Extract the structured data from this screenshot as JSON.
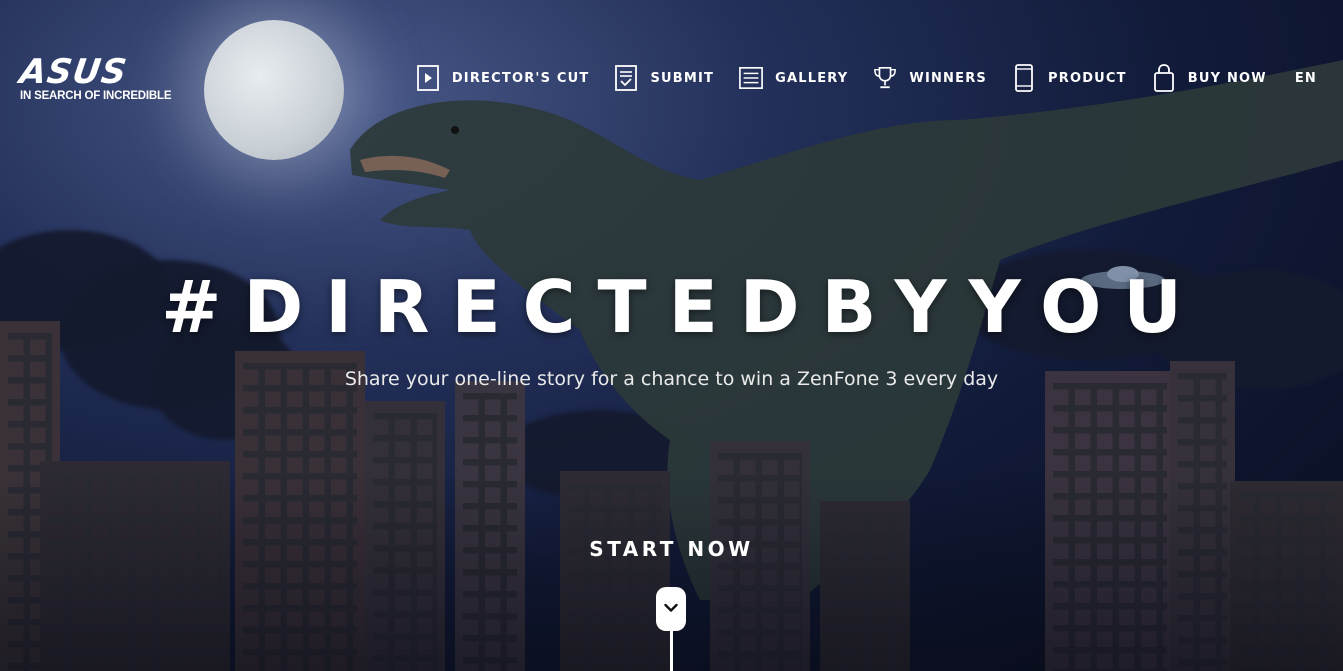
{
  "brand": {
    "logo_text": "ASUS",
    "tagline": "IN SEARCH OF INCREDIBLE"
  },
  "nav": {
    "items": [
      {
        "label": "DIRECTOR'S CUT",
        "icon": "play-icon"
      },
      {
        "label": "SUBMIT",
        "icon": "submit-icon"
      },
      {
        "label": "GALLERY",
        "icon": "gallery-icon"
      },
      {
        "label": "WINNERS",
        "icon": "trophy-icon"
      },
      {
        "label": "PRODUCT",
        "icon": "phone-icon"
      },
      {
        "label": "BUY NOW",
        "icon": "shopping-bag-icon"
      }
    ],
    "language": "EN"
  },
  "hero": {
    "title": "#DIRECTEDBYYOU",
    "subtitle": "Share your one-line story for a chance to win a ZenFone 3 every day",
    "cta": "START NOW"
  }
}
